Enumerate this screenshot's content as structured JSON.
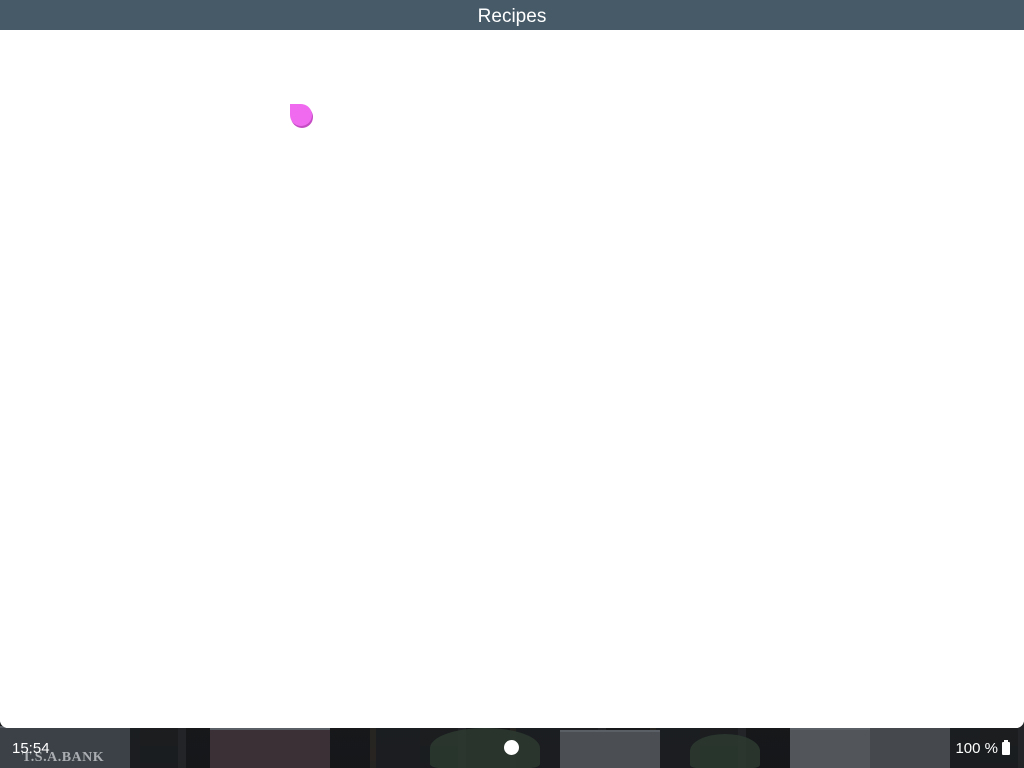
{
  "window": {
    "title": "Recipes"
  },
  "status_bar": {
    "time": "15:54",
    "battery_percent": "100 %",
    "battery_icon": "battery-full-icon",
    "home_icon": "home-dot-icon"
  },
  "wallpaper": {
    "sign_text": "T.S.A.BANK"
  },
  "colors": {
    "title_bar": "#465a68",
    "touch_indicator": "#f06af0",
    "content_background": "#ffffff"
  }
}
